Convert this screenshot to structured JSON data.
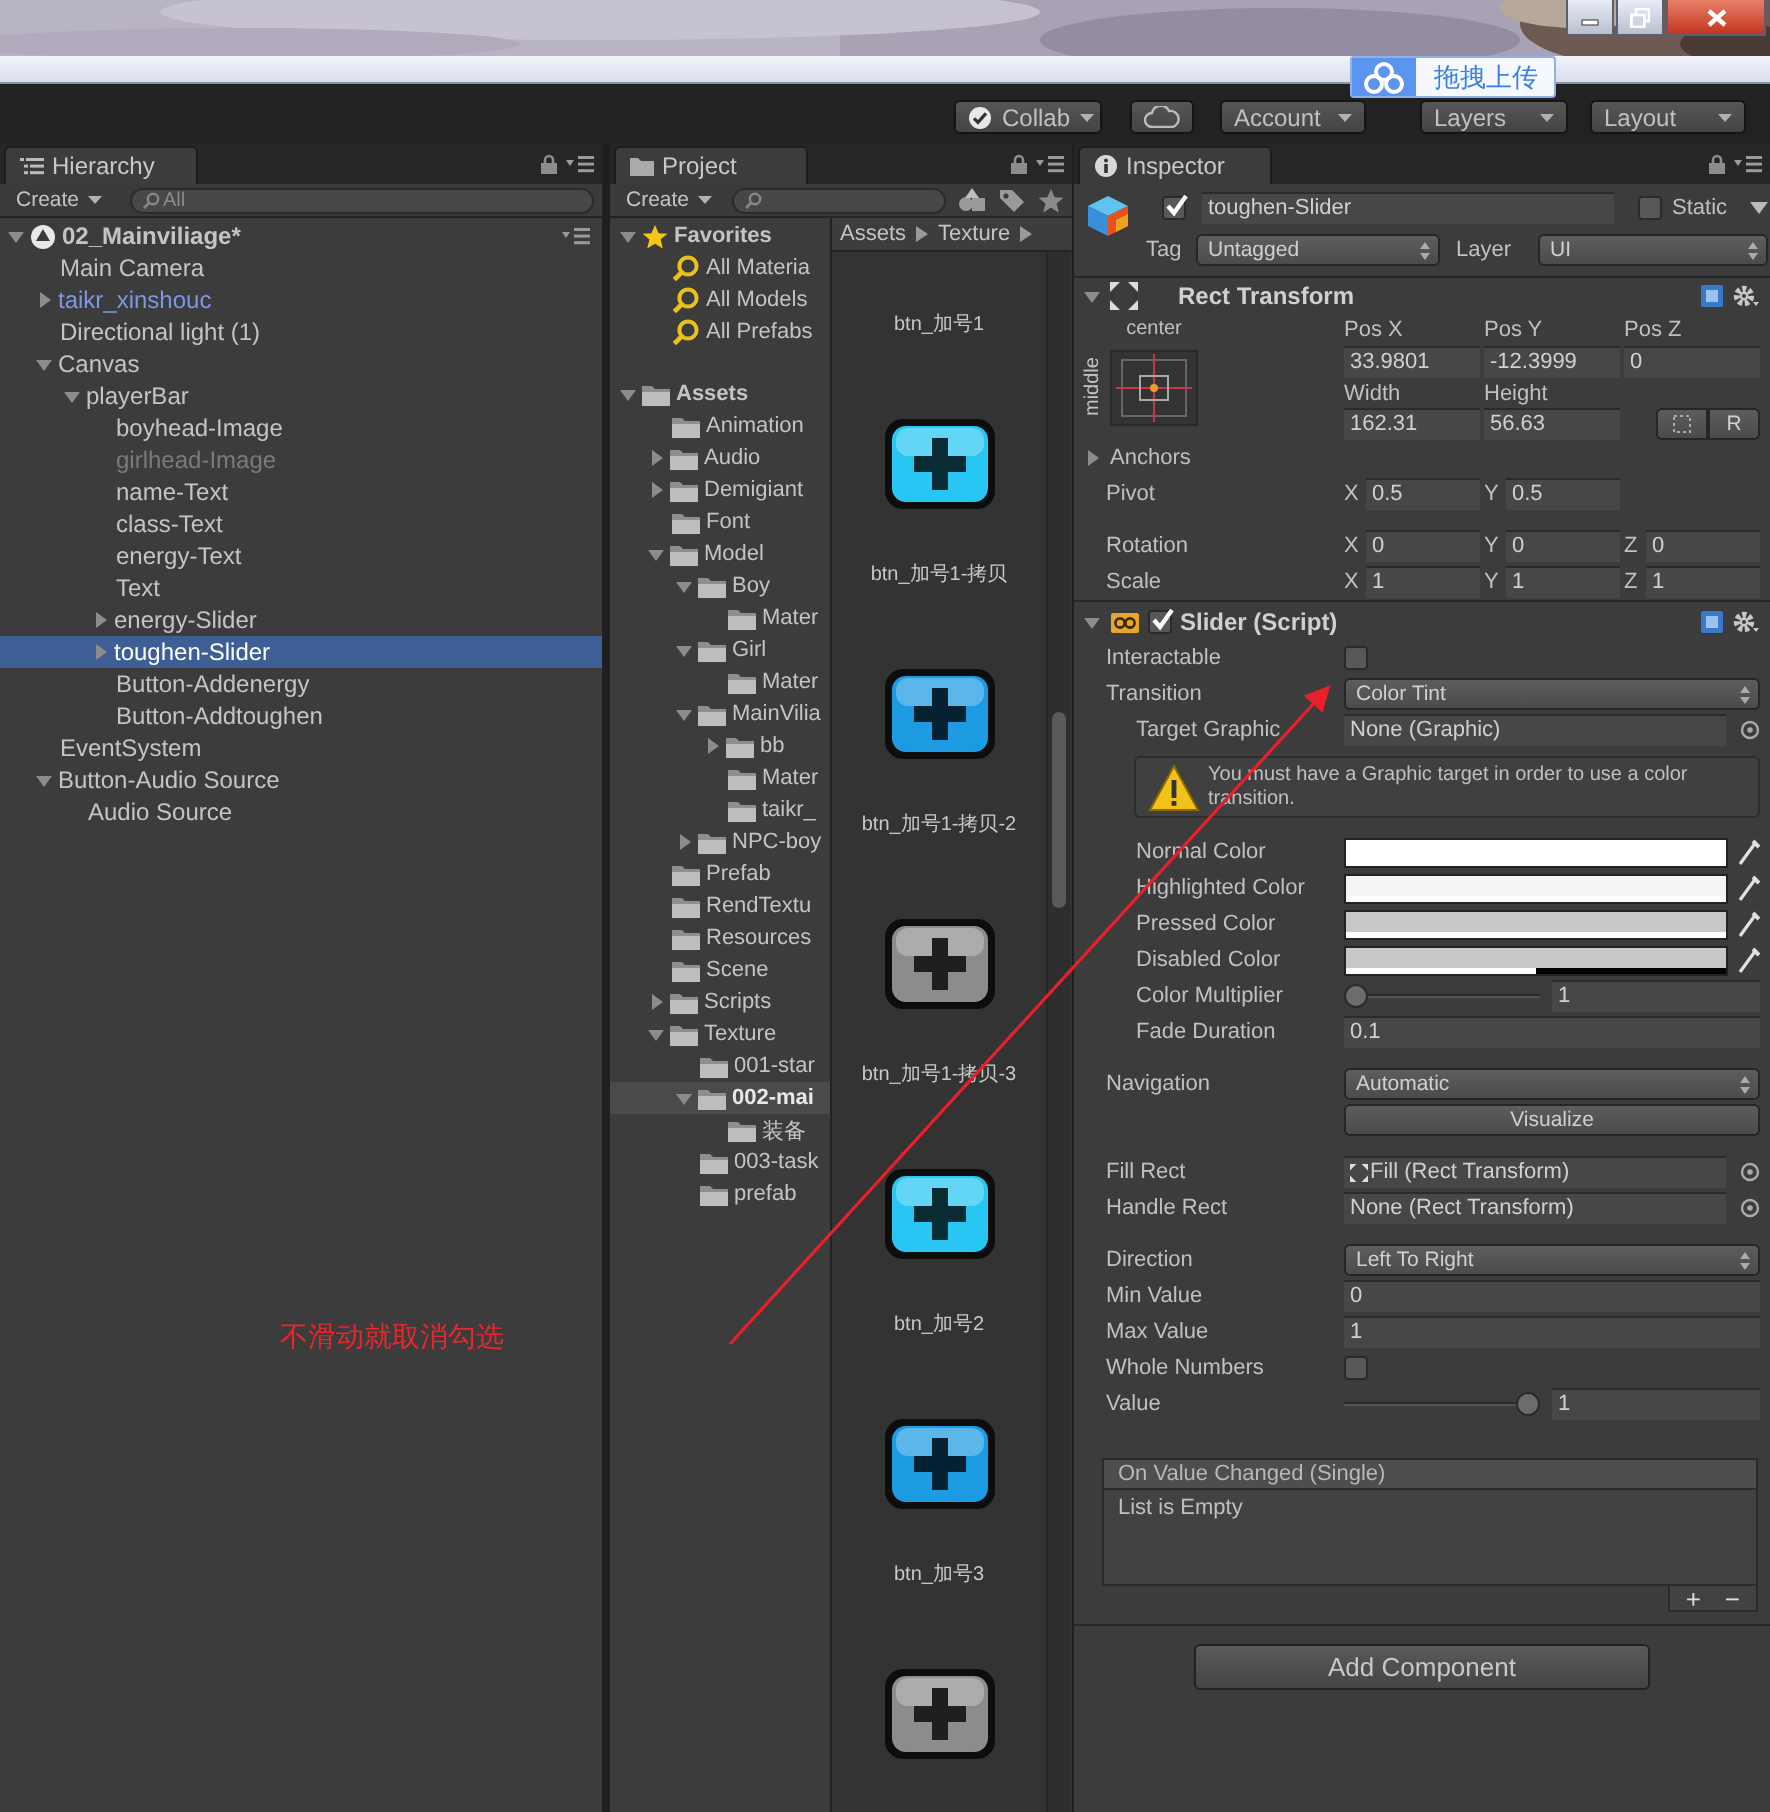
{
  "upload_popup": {
    "label": "拖拽上传"
  },
  "toolbar": {
    "buttons": [
      {
        "kind": "collab",
        "label": "Collab"
      },
      {
        "kind": "cloud"
      },
      {
        "kind": "dropdown",
        "label": "Account"
      },
      {
        "kind": "dropdown",
        "label": "Layers"
      },
      {
        "kind": "dropdown",
        "label": "Layout"
      }
    ]
  },
  "hierarchy": {
    "tab": "Hierarchy",
    "create": "Create",
    "search_placeholder": "All",
    "scene": {
      "label": "02_Mainviliage*",
      "expanded": true,
      "selected": false,
      "children": [
        {
          "label": "Main Camera",
          "kind": "object",
          "active": true,
          "selected": false
        },
        {
          "label": "taikr_xinshouc",
          "kind": "prefab",
          "active": true,
          "selected": false,
          "expanded": false
        },
        {
          "label": "Directional light (1)",
          "kind": "object",
          "active": true,
          "selected": false
        },
        {
          "label": "Canvas",
          "kind": "object",
          "active": true,
          "selected": false,
          "expanded": true,
          "children": [
            {
              "label": "playerBar",
              "active": true,
              "selected": false,
              "expanded": true,
              "children": [
                {
                  "label": "boyhead-Image",
                  "active": true,
                  "selected": false
                },
                {
                  "label": "girlhead-Image",
                  "active": false,
                  "selected": false
                },
                {
                  "label": "name-Text",
                  "active": true,
                  "selected": false
                },
                {
                  "label": "class-Text",
                  "active": true,
                  "selected": false
                },
                {
                  "label": "energy-Text",
                  "active": true,
                  "selected": false
                },
                {
                  "label": "Text",
                  "active": true,
                  "selected": false
                },
                {
                  "label": "energy-Slider",
                  "active": true,
                  "selected": false,
                  "expanded": false
                },
                {
                  "label": "toughen-Slider",
                  "active": true,
                  "selected": true,
                  "expanded": false
                },
                {
                  "label": "Button-Addenergy",
                  "active": true,
                  "selected": false
                },
                {
                  "label": "Button-Addtoughen",
                  "active": true,
                  "selected": false
                }
              ]
            }
          ]
        },
        {
          "label": "EventSystem",
          "kind": "object",
          "active": true,
          "selected": false
        },
        {
          "label": "Button-Audio Source",
          "kind": "object",
          "active": true,
          "selected": false,
          "expanded": true,
          "children": [
            {
              "label": "Audio Source",
              "active": true,
              "selected": false
            }
          ]
        }
      ]
    }
  },
  "project": {
    "tab": "Project",
    "create": "Create",
    "favorites": {
      "label": "Favorites",
      "expanded": true,
      "selected": false,
      "children": [
        {
          "label": "All Materia",
          "selected": false
        },
        {
          "label": "All Models",
          "selected": false
        },
        {
          "label": "All Prefabs",
          "selected": false
        }
      ]
    },
    "assets": {
      "label": "Assets",
      "expanded": true,
      "selected": false,
      "children": [
        {
          "label": "Animation",
          "selected": false
        },
        {
          "label": "Audio",
          "selected": false,
          "expanded": false
        },
        {
          "label": "Demigiant",
          "selected": false,
          "expanded": false
        },
        {
          "label": "Font",
          "selected": false
        },
        {
          "label": "Model",
          "selected": false,
          "expanded": true,
          "children": [
            {
              "label": "Boy",
              "selected": false,
              "expanded": true,
              "children": [
                {
                  "label": "Mater",
                  "selected": false
                }
              ]
            },
            {
              "label": "Girl",
              "selected": false,
              "expanded": true,
              "children": [
                {
                  "label": "Mater",
                  "selected": false
                }
              ]
            },
            {
              "label": "MainVilia",
              "selected": false,
              "expanded": true,
              "children": [
                {
                  "label": "bb",
                  "selected": false,
                  "expanded": false
                },
                {
                  "label": "Mater",
                  "selected": false
                },
                {
                  "label": "taikr_",
                  "selected": false
                }
              ]
            },
            {
              "label": "NPC-boy",
              "selected": false,
              "expanded": false
            }
          ]
        },
        {
          "label": "Prefab",
          "selected": false
        },
        {
          "label": "RendTextu",
          "selected": false
        },
        {
          "label": "Resources",
          "selected": false
        },
        {
          "label": "Scene",
          "selected": false
        },
        {
          "label": "Scripts",
          "selected": false,
          "expanded": false
        },
        {
          "label": "Texture",
          "selected": false,
          "expanded": true,
          "children": [
            {
              "label": "001-star",
              "selected": false
            },
            {
              "label": "002-mai",
              "selected": true,
              "expanded": true,
              "children": [
                {
                  "label": "装备",
                  "selected": false
                }
              ]
            },
            {
              "label": "003-task",
              "selected": false
            },
            {
              "label": "prefab",
              "selected": false
            }
          ]
        }
      ]
    },
    "breadcrumb": [
      "Assets",
      "Texture"
    ],
    "grid": [
      {
        "label": "btn_加号1"
      },
      {
        "label": "btn_加号1-拷贝",
        "color": "#28c6f2"
      },
      {
        "label": "btn_加号1-拷贝-2",
        "color": "#1c9ae2"
      },
      {
        "label": "btn_加号1-拷贝-3",
        "color": "#8c8c8c"
      },
      {
        "label": "btn_加号2",
        "color": "#28c6f2"
      },
      {
        "label": "btn_加号3",
        "color": "#1c9ae2"
      },
      {
        "color": "#8c8c8c"
      }
    ]
  },
  "inspector": {
    "tab": "Inspector",
    "object": {
      "active": true,
      "name": "toughen-Slider",
      "static_label": "Static",
      "static": false,
      "tag_label": "Tag",
      "tag": "Untagged",
      "layer_label": "Layer",
      "layer": "UI"
    },
    "rect_transform": {
      "title": "Rect Transform",
      "expanded": true,
      "anchor_x": "center",
      "anchor_y": "middle",
      "fields": [
        {
          "label": "Pos X",
          "value": "33.9801"
        },
        {
          "label": "Pos Y",
          "value": "-12.3999"
        },
        {
          "label": "Pos Z",
          "value": "0"
        },
        {
          "label": "Width",
          "value": "162.31"
        },
        {
          "label": "Height",
          "value": "56.63"
        }
      ],
      "raw_button": "R",
      "anchors": {
        "label": "Anchors",
        "expanded": false
      },
      "vector_groups": [
        [
          {
            "label": "Pivot",
            "axes": [
              {
                "axis": "X",
                "value": "0.5"
              },
              {
                "axis": "Y",
                "value": "0.5"
              }
            ]
          }
        ],
        [
          {
            "label": "Rotation",
            "axes": [
              {
                "axis": "X",
                "value": "0"
              },
              {
                "axis": "Y",
                "value": "0"
              },
              {
                "axis": "Z",
                "value": "0"
              }
            ]
          },
          {
            "label": "Scale",
            "axes": [
              {
                "axis": "X",
                "value": "1"
              },
              {
                "axis": "Y",
                "value": "1"
              },
              {
                "axis": "Z",
                "value": "1"
              }
            ]
          }
        ]
      ]
    },
    "slider": {
      "title": "Slider (Script)",
      "expanded": true,
      "enabled": true,
      "groups": [
        [
          {
            "kind": "checkbox",
            "label": "Interactable",
            "checked": false
          },
          {
            "kind": "dropdown",
            "label": "Transition",
            "value": "Color Tint",
            "children": [
              {
                "kind": "object",
                "label": "Target Graphic",
                "value": "None (Graphic)"
              },
              {
                "kind": "warning",
                "text": "You must have a Graphic target in order to use a color transition."
              },
              {
                "kind": "color",
                "label": "Normal Color",
                "color": "#ffffff",
                "level": 1
              },
              {
                "kind": "color",
                "label": "Highlighted Color",
                "color": "#f5f5f5",
                "level": 1
              },
              {
                "kind": "color",
                "label": "Pressed Color",
                "color": "#c8c8c8",
                "level": 1
              },
              {
                "kind": "color",
                "label": "Disabled Color",
                "color": "#c8c8c8",
                "level": 0.5
              },
              {
                "kind": "slider",
                "label": "Color Multiplier",
                "level": 0,
                "reading": "1"
              },
              {
                "kind": "number",
                "label": "Fade Duration",
                "value": "0.1"
              }
            ]
          }
        ],
        [
          {
            "kind": "dropdown",
            "label": "Navigation",
            "value": "Automatic"
          },
          {
            "kind": "button",
            "label": "Visualize"
          }
        ],
        [
          {
            "kind": "rect_object",
            "label": "Fill Rect",
            "value": "Fill (Rect Transform)"
          },
          {
            "kind": "object",
            "label": "Handle Rect",
            "value": "None (Rect Transform)"
          }
        ],
        [
          {
            "kind": "dropdown",
            "label": "Direction",
            "value": "Left To Right"
          },
          {
            "kind": "number",
            "label": "Min Value",
            "value": "0"
          },
          {
            "kind": "number",
            "label": "Max Value",
            "value": "1"
          },
          {
            "kind": "checkbox",
            "label": "Whole Numbers",
            "checked": false
          },
          {
            "kind": "slider",
            "label": "Value",
            "level": 1,
            "reading": "1"
          }
        ]
      ]
    },
    "event": {
      "title": "On Value Changed (Single)",
      "empty": "List is Empty",
      "add": "+",
      "remove": "−"
    },
    "add_component": "Add Component"
  },
  "annotation": {
    "text": "不滑动就取消勾选"
  }
}
